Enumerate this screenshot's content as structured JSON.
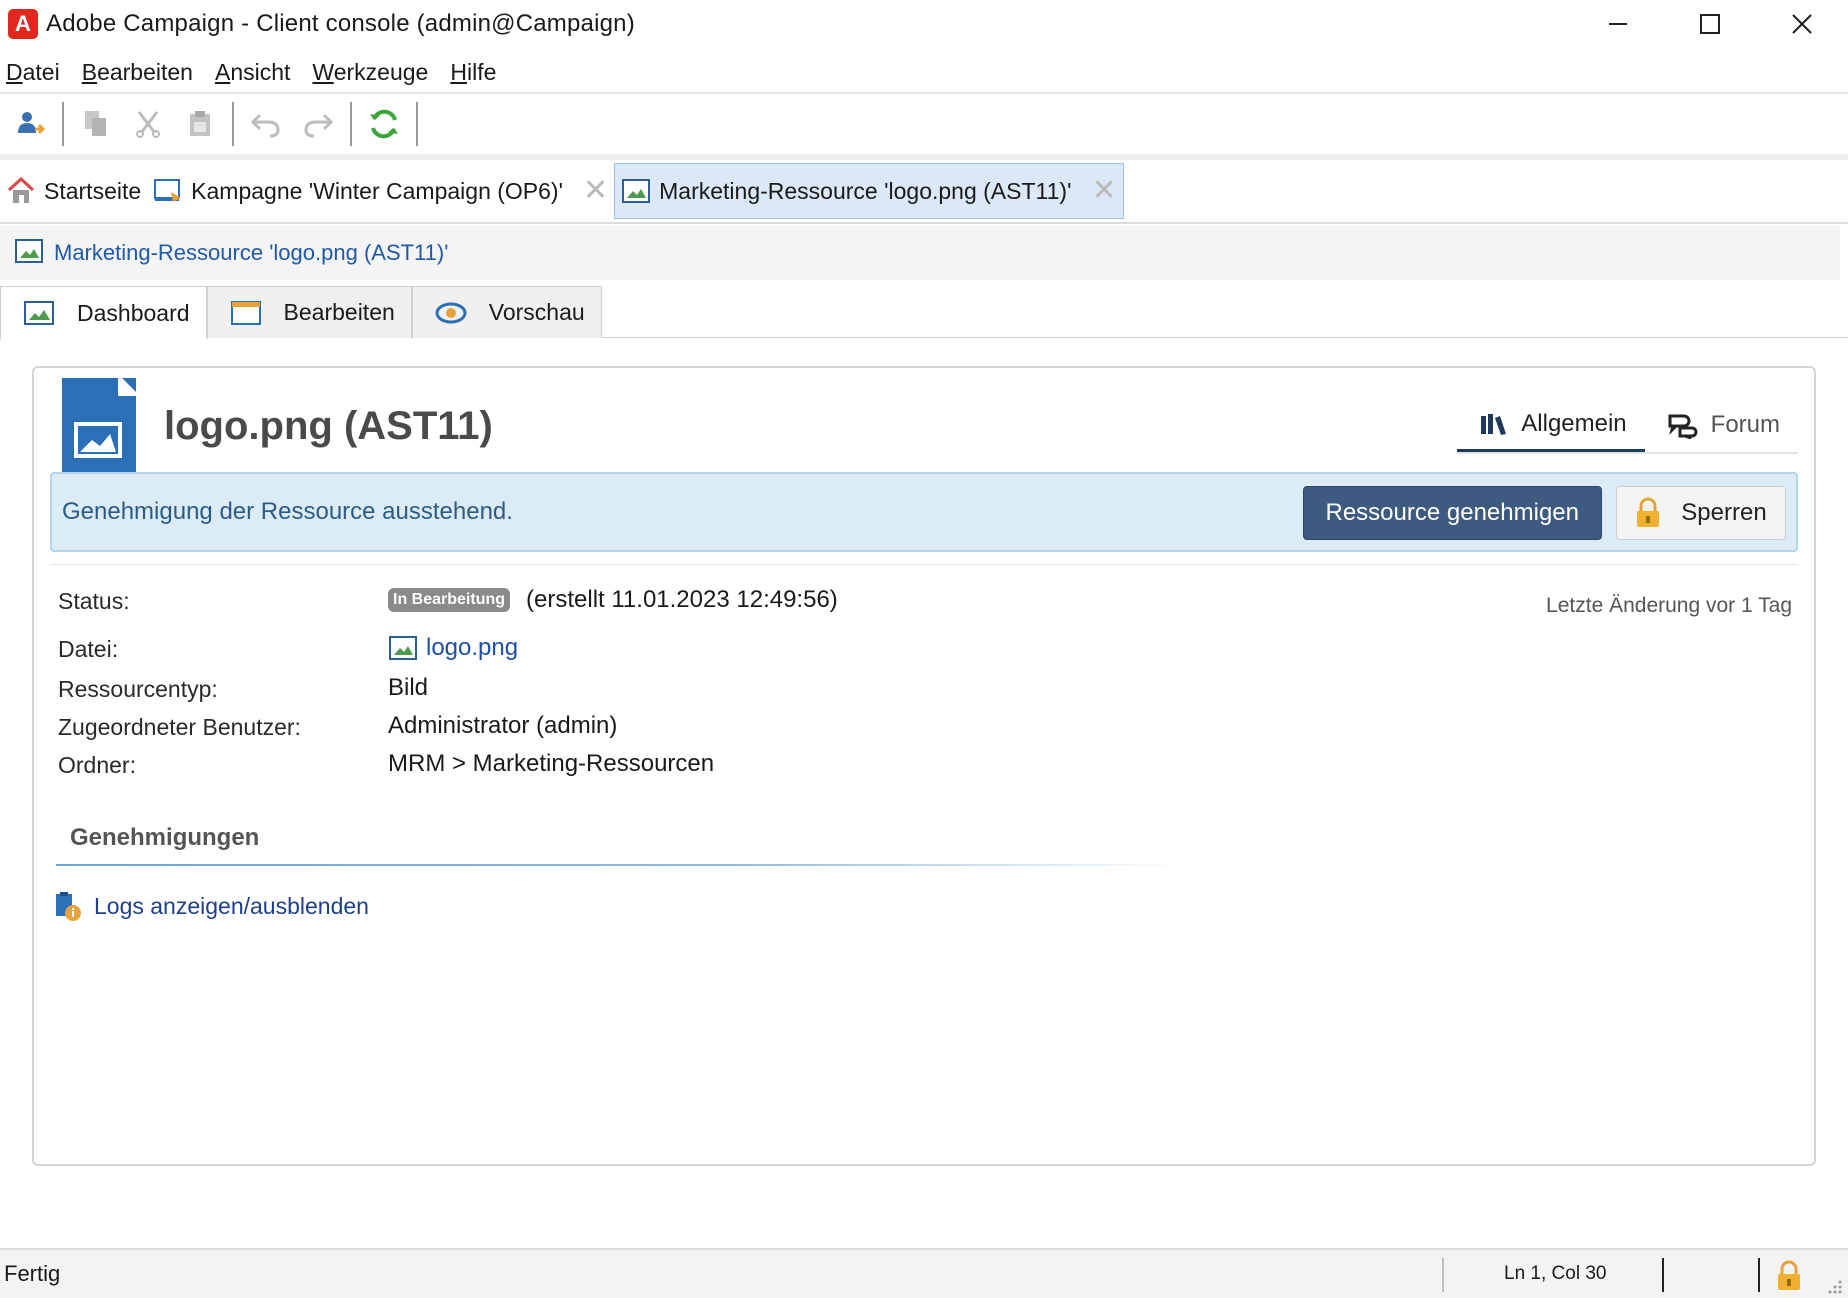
{
  "window": {
    "title": "Adobe Campaign - Client console (admin@Campaign)",
    "app_icon_letter": "A"
  },
  "menu": {
    "items": [
      "Datei",
      "Bearbeiten",
      "Ansicht",
      "Werkzeuge",
      "Hilfe"
    ],
    "mnemonics": [
      "D",
      "B",
      "A",
      "W",
      "H"
    ]
  },
  "toolbar": {
    "icons": [
      "new-user-icon",
      "copy-icon",
      "cut-icon",
      "paste-icon",
      "undo-icon",
      "redo-icon",
      "refresh-icon"
    ]
  },
  "doc_tabs": [
    {
      "label": "Startseite",
      "icon": "home-icon",
      "closable": false
    },
    {
      "label": "Kampagne 'Winter Campaign (OP6)'",
      "icon": "campaign-icon",
      "closable": true
    },
    {
      "label": "Marketing-Ressource 'logo.png (AST11)'",
      "icon": "image-resource-icon",
      "closable": true,
      "active": true
    }
  ],
  "breadcrumb": {
    "label": "Marketing-Ressource 'logo.png",
    "label_suffix": "(AST11)'"
  },
  "view_tabs": [
    {
      "label": "Dashboard",
      "icon": "dashboard-icon",
      "active": true
    },
    {
      "label": "Bearbeiten",
      "icon": "edit-window-icon"
    },
    {
      "label": "Vorschau",
      "icon": "eye-icon"
    }
  ],
  "resource": {
    "title": "logo.png (AST11)",
    "tabs": [
      {
        "label": "Allgemein",
        "icon": "library-icon",
        "active": true
      },
      {
        "label": "Forum",
        "icon": "chat-icon"
      }
    ],
    "approval": {
      "message": "Genehmigung der Ressource ausstehend.",
      "approve_button": "Ressource genehmigen",
      "lock_button": "Sperren"
    },
    "last_change": "Letzte Änderung vor 1 Tag",
    "fields": {
      "status_label": "Status:",
      "status_badge": "In Bearbeitung",
      "status_created": "(erstellt 11.01.2023 12:49:56)",
      "file_label": "Datei:",
      "file_value": "logo.png",
      "type_label": "Ressourcentyp:",
      "type_value": "Bild",
      "user_label": "Zugeordneter Benutzer:",
      "user_value": "Administrator (admin)",
      "folder_label": "Ordner:",
      "folder_value": "MRM > Marketing-Ressourcen"
    },
    "approvals_section": "Genehmigungen",
    "logs_link": "Logs anzeigen/ausblenden"
  },
  "statusbar": {
    "text": "Fertig",
    "position": "Ln 1, Col 30"
  },
  "colors": {
    "accent": "#3d5a80",
    "link": "#1f4fa8",
    "approval_bg": "#dcecf7",
    "active_tab_bg": "#dbe8f7",
    "app_red": "#e0281e"
  }
}
